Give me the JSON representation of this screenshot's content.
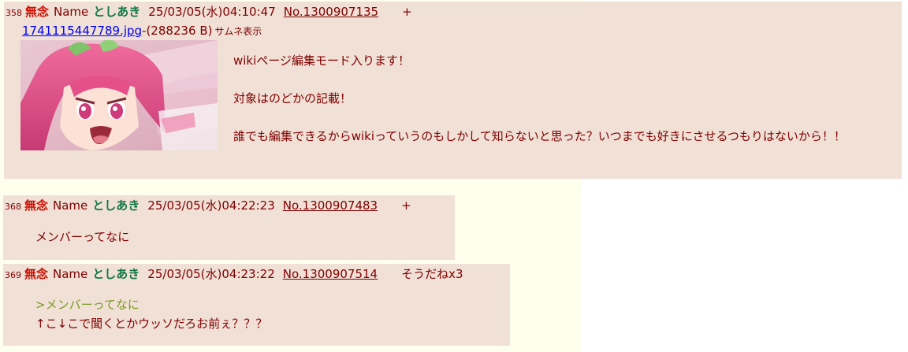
{
  "posts": [
    {
      "number": "358",
      "subject": "無念",
      "name_label": "Name",
      "name": "としあき",
      "datetime": "25/03/05(水)04:10:47",
      "post_no": "No.1300907135",
      "delete_mark": "+",
      "file": {
        "filename": "1741115447789.jpg",
        "size": "-(288236 B)",
        "thumb_toggle": "サムネ表示"
      },
      "lines": [
        "wikiページ編集モード入ります！",
        "対象はのどかの記載！",
        "誰でも編集できるからwikiっていうのもしかして知らないと思った？いつまでも好きにさせるつもりはないから！！"
      ]
    },
    {
      "number": "368",
      "subject": "無念",
      "name_label": "Name",
      "name": "としあき",
      "datetime": "25/03/05(水)04:22:23",
      "post_no": "No.1300907483",
      "delete_mark": "+",
      "lines": [
        "メンバーってなに"
      ]
    },
    {
      "number": "369",
      "subject": "無念",
      "name_label": "Name",
      "name": "としあき",
      "datetime": "25/03/05(水)04:23:22",
      "post_no": "No.1300907514",
      "soudane": "そうだねx3",
      "quote": ">メンバーってなに",
      "lines": [
        "↑こ↓こで聞くとかウッソだろお前ぇ？？？"
      ]
    }
  ],
  "colors": {
    "page_bg": "#ffffee",
    "reply_bg": "#f0e0d6",
    "text": "#800000",
    "subject": "#cc1105",
    "name": "#117743",
    "link": "#0000ee",
    "quote": "#789922"
  }
}
